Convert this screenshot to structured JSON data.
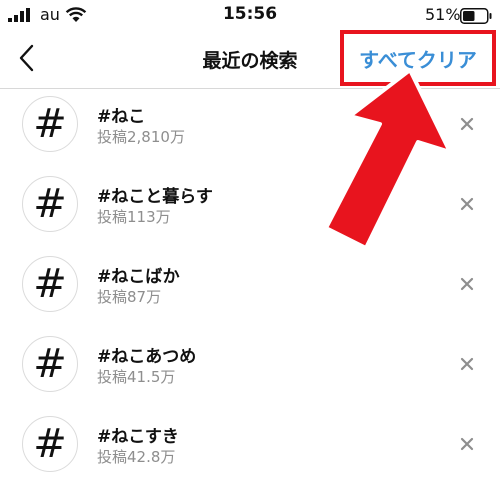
{
  "status_bar": {
    "carrier": "au",
    "time": "15:56",
    "battery_percent": "51%",
    "battery_level": 0.51
  },
  "nav": {
    "back_icon": "chevron-left-icon",
    "title": "最近の検索",
    "clear_all_label": "すべてクリア"
  },
  "colors": {
    "accent_blue": "#3a8ed6",
    "highlight_red": "#e8141e"
  },
  "searches": [
    {
      "tag": "#ねこ",
      "posts": "投稿2,810万"
    },
    {
      "tag": "#ねこと暮らす",
      "posts": "投稿113万"
    },
    {
      "tag": "#ねこばか",
      "posts": "投稿87万"
    },
    {
      "tag": "#ねこあつめ",
      "posts": "投稿41.5万"
    },
    {
      "tag": "#ねこすき",
      "posts": "投稿42.8万"
    }
  ],
  "hash_symbol": "#"
}
